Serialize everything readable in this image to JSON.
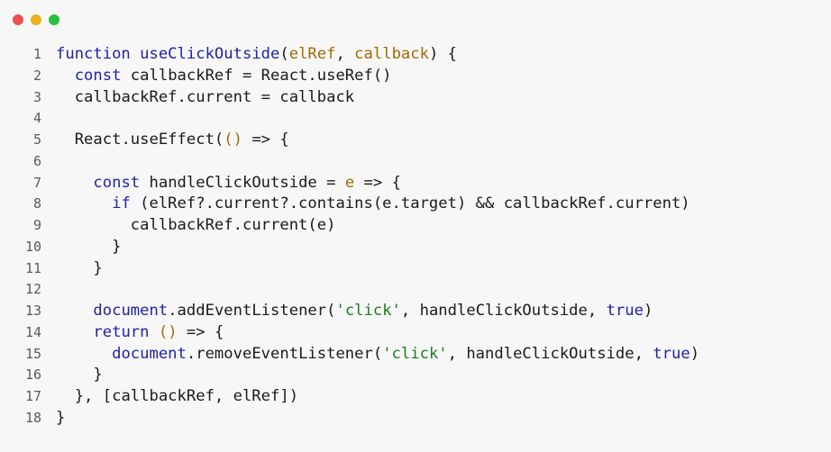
{
  "window": {
    "dot_colors": {
      "red": "#ee4f4f",
      "yellow": "#e9b020",
      "green": "#27c13c"
    }
  },
  "colors": {
    "keyword": "#1f22a8",
    "param": "#a36a00",
    "string": "#1d7d1d",
    "text": "#1a1a1a",
    "line_number": "#5a5a5a",
    "background": "#f7f7f7"
  },
  "code": {
    "language": "javascript",
    "lines": [
      {
        "n": "1",
        "indent": "",
        "tokens": [
          {
            "t": "function ",
            "k": "kw"
          },
          {
            "t": "useClickOutside",
            "k": "fn"
          },
          {
            "t": "(",
            "k": "txt"
          },
          {
            "t": "elRef",
            "k": "par"
          },
          {
            "t": ", ",
            "k": "txt"
          },
          {
            "t": "callback",
            "k": "par"
          },
          {
            "t": ") {",
            "k": "txt"
          }
        ]
      },
      {
        "n": "2",
        "indent": "  ",
        "tokens": [
          {
            "t": "const ",
            "k": "kw"
          },
          {
            "t": "callbackRef = React.useRef()",
            "k": "txt"
          }
        ]
      },
      {
        "n": "3",
        "indent": "  ",
        "tokens": [
          {
            "t": "callbackRef.current = callback",
            "k": "txt"
          }
        ]
      },
      {
        "n": "4",
        "indent": "",
        "tokens": []
      },
      {
        "n": "5",
        "indent": "  ",
        "tokens": [
          {
            "t": "React.useEffect(",
            "k": "txt"
          },
          {
            "t": "()",
            "k": "par"
          },
          {
            "t": " => {",
            "k": "txt"
          }
        ]
      },
      {
        "n": "6",
        "indent": "",
        "tokens": []
      },
      {
        "n": "7",
        "indent": "    ",
        "tokens": [
          {
            "t": "const ",
            "k": "kw"
          },
          {
            "t": "handleClickOutside = ",
            "k": "txt"
          },
          {
            "t": "e",
            "k": "par"
          },
          {
            "t": " => {",
            "k": "txt"
          }
        ]
      },
      {
        "n": "8",
        "indent": "      ",
        "tokens": [
          {
            "t": "if ",
            "k": "kw"
          },
          {
            "t": "(elRef?.current?.contains(e.target) && callbackRef.current)",
            "k": "txt"
          }
        ]
      },
      {
        "n": "9",
        "indent": "        ",
        "tokens": [
          {
            "t": "callbackRef.current(e)",
            "k": "txt"
          }
        ]
      },
      {
        "n": "10",
        "indent": "      ",
        "tokens": [
          {
            "t": "}",
            "k": "txt"
          }
        ]
      },
      {
        "n": "11",
        "indent": "    ",
        "tokens": [
          {
            "t": "}",
            "k": "txt"
          }
        ]
      },
      {
        "n": "12",
        "indent": "",
        "tokens": []
      },
      {
        "n": "13",
        "indent": "    ",
        "tokens": [
          {
            "t": "document",
            "k": "kw"
          },
          {
            "t": ".addEventListener(",
            "k": "txt"
          },
          {
            "t": "'click'",
            "k": "str"
          },
          {
            "t": ", handleClickOutside, ",
            "k": "txt"
          },
          {
            "t": "true",
            "k": "kw"
          },
          {
            "t": ")",
            "k": "txt"
          }
        ]
      },
      {
        "n": "14",
        "indent": "    ",
        "tokens": [
          {
            "t": "return ",
            "k": "kw"
          },
          {
            "t": "()",
            "k": "par"
          },
          {
            "t": " => {",
            "k": "txt"
          }
        ]
      },
      {
        "n": "15",
        "indent": "      ",
        "tokens": [
          {
            "t": "document",
            "k": "kw"
          },
          {
            "t": ".removeEventListener(",
            "k": "txt"
          },
          {
            "t": "'click'",
            "k": "str"
          },
          {
            "t": ", handleClickOutside, ",
            "k": "txt"
          },
          {
            "t": "true",
            "k": "kw"
          },
          {
            "t": ")",
            "k": "txt"
          }
        ]
      },
      {
        "n": "16",
        "indent": "    ",
        "tokens": [
          {
            "t": "}",
            "k": "txt"
          }
        ]
      },
      {
        "n": "17",
        "indent": "  ",
        "tokens": [
          {
            "t": "}, [callbackRef, elRef])",
            "k": "txt"
          }
        ]
      },
      {
        "n": "18",
        "indent": "",
        "tokens": [
          {
            "t": "}",
            "k": "txt"
          }
        ]
      }
    ]
  }
}
